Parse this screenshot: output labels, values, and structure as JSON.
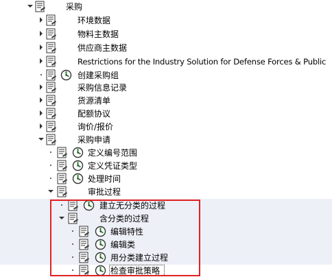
{
  "tree": {
    "items": [
      {
        "label": "采购",
        "state": "open",
        "exec": false
      },
      {
        "label": "环境数据",
        "state": "closed",
        "exec": false
      },
      {
        "label": "物料主数据",
        "state": "closed",
        "exec": false
      },
      {
        "label": "供应商主数据",
        "state": "closed",
        "exec": false
      },
      {
        "label": "Restrictions for the Industry Solution for Defense Forces & Public",
        "state": "closed",
        "exec": false
      },
      {
        "label": "创建采购组",
        "state": "leaf",
        "exec": true
      },
      {
        "label": "采购信息记录",
        "state": "closed",
        "exec": false
      },
      {
        "label": "货源清单",
        "state": "closed",
        "exec": false
      },
      {
        "label": "配额协议",
        "state": "closed",
        "exec": false
      },
      {
        "label": "询价/报价",
        "state": "closed",
        "exec": false
      },
      {
        "label": "采购申请",
        "state": "open",
        "exec": false
      },
      {
        "label": "定义编号范围",
        "state": "leaf",
        "exec": true
      },
      {
        "label": "定义凭证类型",
        "state": "leaf",
        "exec": true
      },
      {
        "label": "处理时间",
        "state": "leaf",
        "exec": true
      },
      {
        "label": "审批过程",
        "state": "open",
        "exec": false
      },
      {
        "label": "建立无分类的过程",
        "state": "leaf",
        "exec": true
      },
      {
        "label": "含分类的过程",
        "state": "open",
        "exec": false
      },
      {
        "label": "编辑特性",
        "state": "leaf",
        "exec": true
      },
      {
        "label": "编辑类",
        "state": "leaf",
        "exec": true
      },
      {
        "label": "用分类建立过程",
        "state": "leaf",
        "exec": true
      },
      {
        "label": "检查审批策略",
        "state": "leaf",
        "exec": true
      }
    ]
  },
  "colors": {
    "row_shade": "#eef0f8",
    "highlight_frame": "#e02020",
    "exec_icon": "#2e8b2e"
  },
  "icons": {
    "node": "document-icon",
    "execute": "execute-clock-icon"
  }
}
